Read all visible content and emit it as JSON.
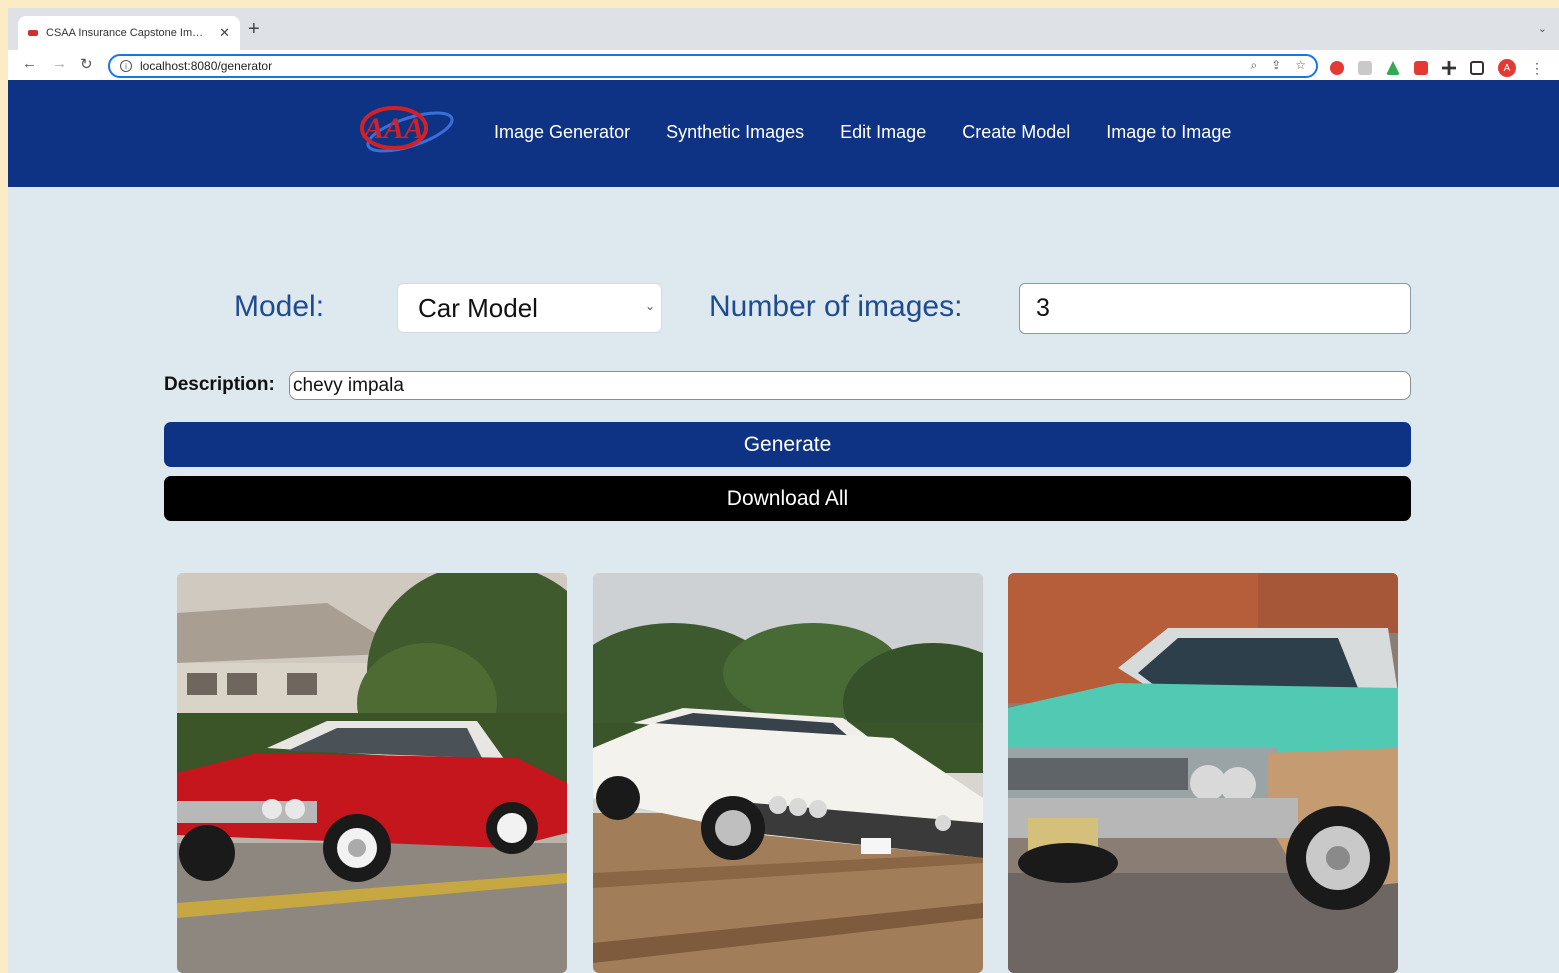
{
  "browser": {
    "tab_title": "CSAA Insurance Capstone Im…",
    "url": "localhost:8080/generator",
    "profile_initial": "A"
  },
  "nav": {
    "links": [
      "Image Generator",
      "Synthetic Images",
      "Edit Image",
      "Create Model",
      "Image to Image"
    ]
  },
  "form": {
    "model_label": "Model:",
    "model_value": "Car Model",
    "num_images_label": "Number of images:",
    "num_images_value": "3",
    "description_label": "Description:",
    "description_value": "chevy impala"
  },
  "buttons": {
    "generate": "Generate",
    "download_all": "Download All"
  },
  "colors": {
    "navbar": "#0f3384",
    "page_bg": "#dde9ee",
    "label_blue": "#1f4b8f",
    "generate_btn": "#0f3384",
    "download_btn": "#000000"
  },
  "images": [
    {
      "name": "generated-image-1",
      "car_color": "#c4161c"
    },
    {
      "name": "generated-image-2",
      "car_color": "#f4f2ec"
    },
    {
      "name": "generated-image-3",
      "car_color": "#52c9b3"
    }
  ]
}
